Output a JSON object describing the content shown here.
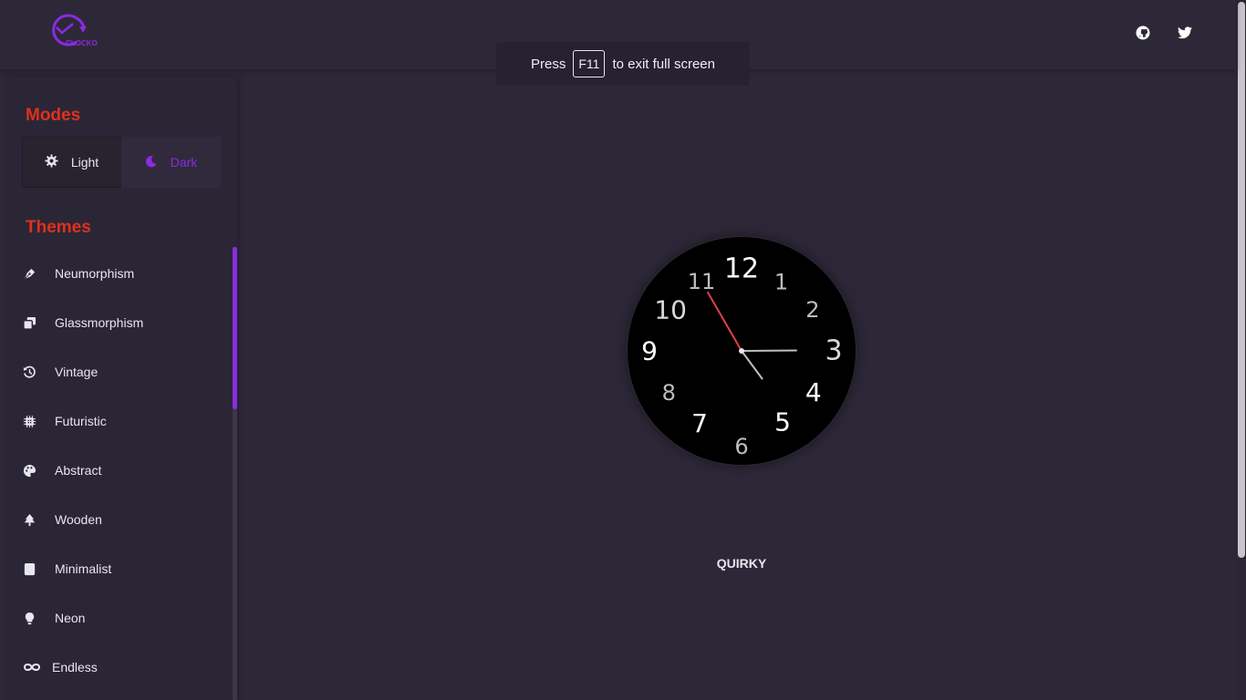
{
  "app": {
    "logo_text": "CLOCKO"
  },
  "header": {
    "icons": [
      "github-icon",
      "twitter-icon"
    ]
  },
  "toast": {
    "prefix": "Press",
    "key": "F11",
    "suffix": "to exit full screen"
  },
  "sidebar": {
    "modes_title": "Modes",
    "modes": [
      {
        "label": "Light",
        "icon": "sun-gear-icon",
        "active": false
      },
      {
        "label": "Dark",
        "icon": "moon-icon",
        "active": true
      }
    ],
    "themes_title": "Themes",
    "themes": [
      {
        "label": "Neumorphism",
        "icon": "pen-nib-icon"
      },
      {
        "label": "Glassmorphism",
        "icon": "layers-icon"
      },
      {
        "label": "Vintage",
        "icon": "history-icon"
      },
      {
        "label": "Futuristic",
        "icon": "chip-icon"
      },
      {
        "label": "Abstract",
        "icon": "palette-icon"
      },
      {
        "label": "Wooden",
        "icon": "tree-icon"
      },
      {
        "label": "Minimalist",
        "icon": "square-icon"
      },
      {
        "label": "Neon",
        "icon": "bulb-icon"
      },
      {
        "label": "Endless",
        "icon": "infinity-icon"
      }
    ]
  },
  "clock": {
    "numerals": [
      "12",
      "1",
      "2",
      "3",
      "4",
      "5",
      "6",
      "7",
      "8",
      "9",
      "10",
      "11"
    ],
    "time": {
      "hour": 4,
      "minute": 23,
      "second": 55
    },
    "colors": {
      "face": "#000000",
      "second_hand": "#e0404a",
      "hands": "#bfbfbf"
    }
  },
  "theme_name": "QUIRKY",
  "colors": {
    "accent": "#8a2be2",
    "section_title": "#e0301e",
    "background": "#2d2838"
  }
}
